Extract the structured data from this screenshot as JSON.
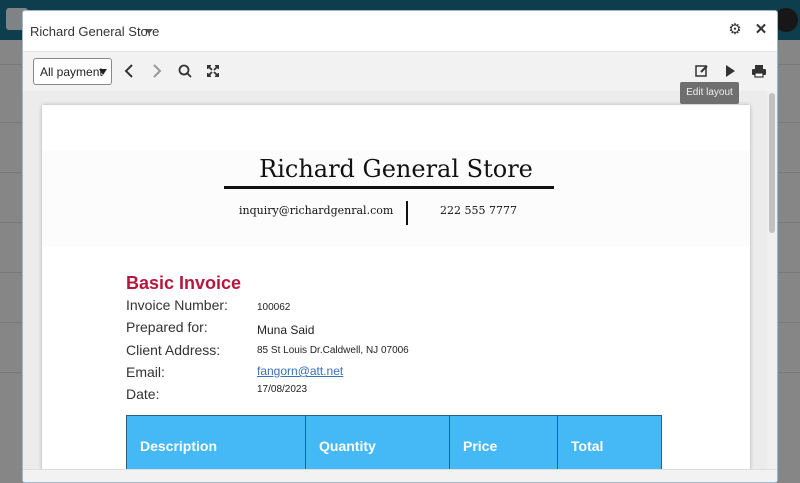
{
  "modal": {
    "title": "Richard General Store",
    "icons": {
      "settings": "gear-icon",
      "close": "close-icon"
    }
  },
  "toolbar": {
    "filter_selected": "All payment",
    "icons": [
      "chevron-left-icon",
      "chevron-right-icon",
      "search-icon",
      "fullscreen-icon",
      "edit-layout-icon",
      "play-icon",
      "print-icon"
    ],
    "tooltip": "Edit layout"
  },
  "document": {
    "store_name": "Richard General Store",
    "email": "inquiry@richardgenral.com",
    "phone": "222 555 7777",
    "invoice_title": "Basic Invoice",
    "fields": {
      "invoice_number_label": "Invoice Number:",
      "invoice_number": "100062",
      "prepared_for_label": "Prepared for:",
      "prepared_for": "Muna Said",
      "client_address_label": "Client Address:",
      "client_address": "85 St Louis Dr.Caldwell, NJ 07006",
      "email_label": "Email:",
      "email": "fangorn@att.net",
      "date_label": "Date:",
      "date": "17/08/2023"
    },
    "table_headers": [
      "Description",
      "Quantity",
      "Price",
      "Total"
    ]
  },
  "colors": {
    "accent": "#b5183f",
    "table_header": "#44b9f5",
    "link": "#3b6fb6",
    "topbar": "#1a6f8f"
  }
}
